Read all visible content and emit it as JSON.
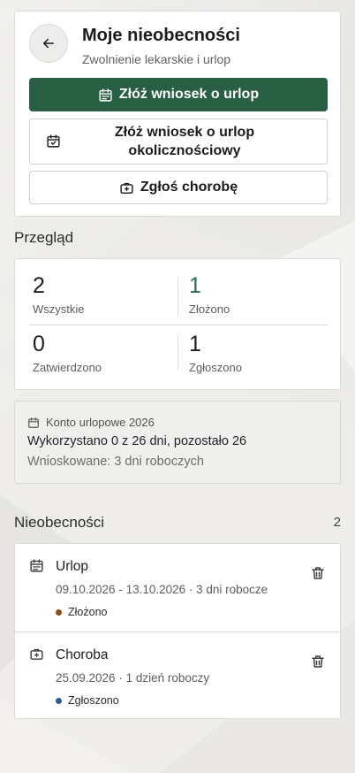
{
  "header": {
    "title": "Moje nieobecności",
    "subtitle": "Zwolnienie lekarskie i urlop",
    "back_icon": "arrow-left-icon"
  },
  "actions": {
    "leave_request": "Złóż wniosek o urlop",
    "special_leave_request": "Złóż wniosek o urlop okolicznościowy",
    "report_sickness": "Zgłoś chorobę"
  },
  "overview": {
    "title": "Przegląd",
    "stats": [
      {
        "value": "2",
        "label": "Wszystkie"
      },
      {
        "value": "1",
        "label": "Złożono"
      },
      {
        "value": "0",
        "label": "Zatwierdzono"
      },
      {
        "value": "1",
        "label": "Zgłoszono"
      }
    ]
  },
  "account": {
    "heading": "Konto urlopowe 2026",
    "usage": "Wykorzystano 0 z 26 dni, pozostało 26",
    "requested": "Wnioskowane: 3 dni roboczych"
  },
  "absences": {
    "title": "Nieobecności",
    "count": "2",
    "items": [
      {
        "type": "Urlop",
        "dates": "09.10.2026 - 13.10.2026 · 3 dni robocze",
        "status": "Złożono",
        "status_color": "#8a4e12",
        "icon": "calendar-icon"
      },
      {
        "type": "Choroba",
        "dates": "25.09.2026 · 1 dzień roboczy",
        "status": "Zgłoszono",
        "status_color": "#2c5a9c",
        "icon": "medical-kit-icon"
      }
    ]
  },
  "colors": {
    "primary": "#285e41",
    "accent_number": "#2a6c49",
    "background": "#eeede9"
  }
}
